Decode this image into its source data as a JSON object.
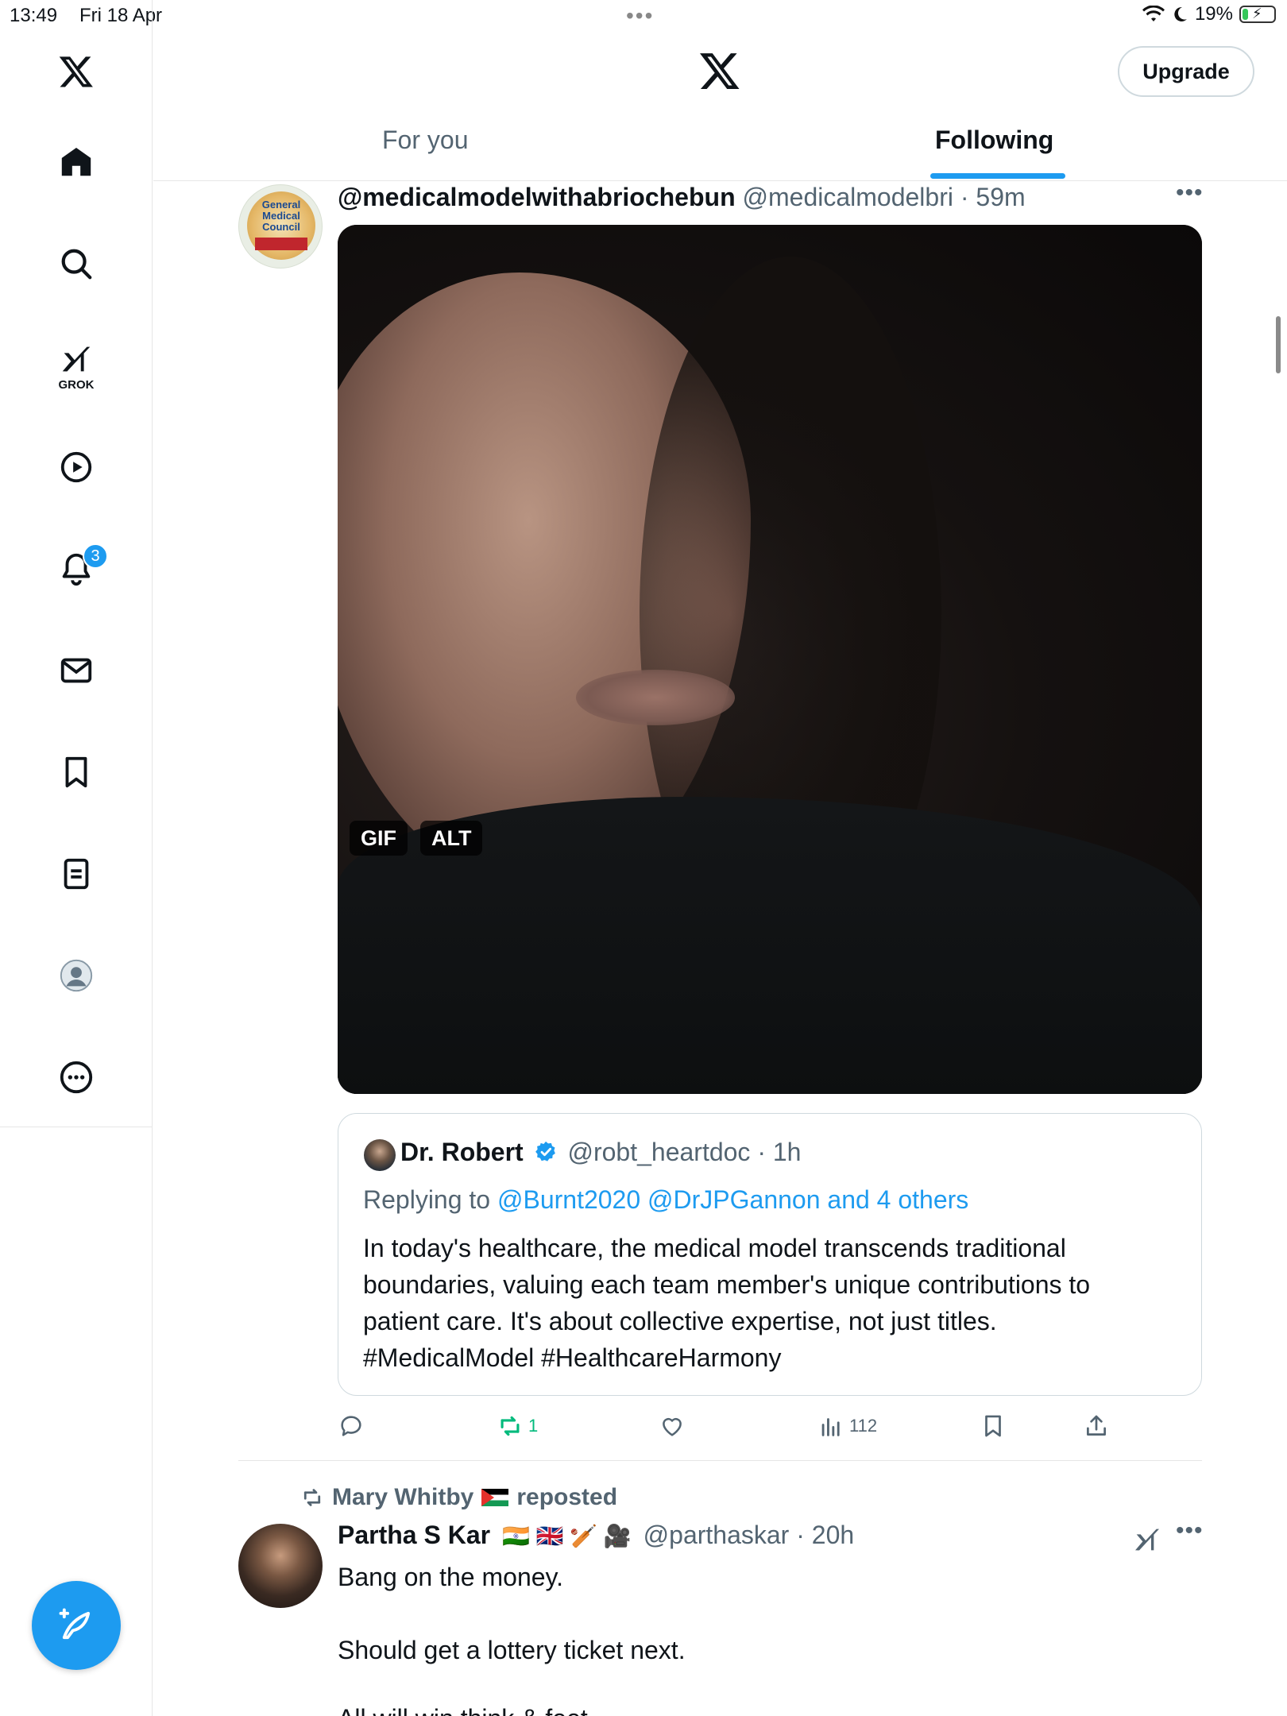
{
  "status_bar": {
    "time": "13:49",
    "date": "Fri 18 Apr",
    "battery_percent": "19%",
    "battery_level": 0.19
  },
  "sidebar": {
    "grok_label": "GROK",
    "notification_count": "3",
    "items": [
      {
        "name": "x-logo-icon"
      },
      {
        "name": "home-icon"
      },
      {
        "name": "search-icon"
      },
      {
        "name": "grok-icon"
      },
      {
        "name": "video-icon"
      },
      {
        "name": "notifications-icon"
      },
      {
        "name": "messages-icon"
      },
      {
        "name": "bookmarks-icon"
      },
      {
        "name": "lists-icon"
      },
      {
        "name": "profile-icon"
      },
      {
        "name": "more-icon"
      }
    ]
  },
  "header": {
    "upgrade_label": "Upgrade",
    "tabs": [
      {
        "label": "For you",
        "active": false
      },
      {
        "label": "Following",
        "active": true
      }
    ]
  },
  "tweet1": {
    "display_name": "@medicalmodelwithabriochebun",
    "handle": "@medicalmodelbri",
    "time": "· 59m",
    "avatar_text": "General Medical Council",
    "media_badges": [
      "GIF",
      "ALT"
    ],
    "quote": {
      "name": "Dr. Robert",
      "handle": "@robt_heartdoc",
      "time": "· 1h",
      "replying_prefix": "Replying to ",
      "replying_to": "@Burnt2020 @DrJPGannon and 4 others",
      "text": "In today's healthcare, the medical model transcends traditional boundaries, valuing each team member's unique contributions to patient care. It's about collective expertise, not just titles. #MedicalModel #HealthcareHarmony"
    },
    "actions": {
      "replies": "",
      "reposts": "1",
      "likes": "",
      "views": "112"
    }
  },
  "tweet2": {
    "reposted_by": "Mary Whitby",
    "reposted_suffix": "reposted",
    "display_name": "Partha S Kar",
    "flags": "🇮🇳 🇬🇧 🏏 🎥",
    "handle": "@parthaskar",
    "time": "· 20h",
    "text": "Bang on the money.\n\nShould get a lottery ticket next.",
    "text_cut": "All will win think & feet"
  },
  "colors": {
    "accent": "#1d9bf0",
    "secondary_text": "#536471",
    "repost_green": "#00ba7c",
    "border": "#cfd9de"
  }
}
